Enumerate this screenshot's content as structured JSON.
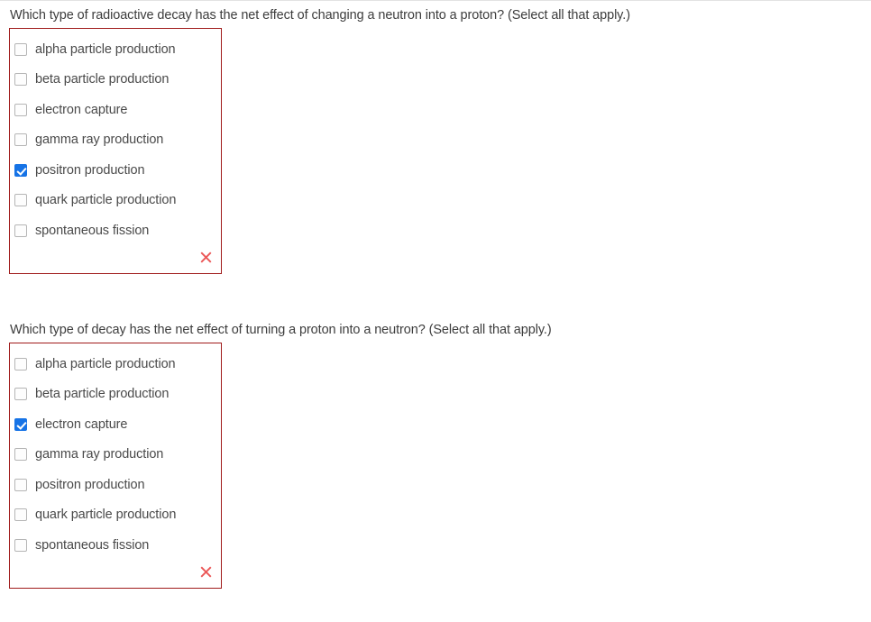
{
  "colors": {
    "box_border": "#a01b1b",
    "checkbox_checked": "#1673e6",
    "x_mark": "#eb5757",
    "question_text": "#3d3d3d",
    "option_text": "#4a4a4a",
    "top_rule": "#e2e2e2"
  },
  "questions": [
    {
      "id": "q1",
      "prompt": "Which type of radioactive decay has the net effect of changing a neutron into a proton? (Select all that apply.)",
      "result_icon": "x-mark-icon",
      "options": [
        {
          "label": "alpha particle production",
          "checked": false
        },
        {
          "label": "beta particle production",
          "checked": false
        },
        {
          "label": "electron capture",
          "checked": false
        },
        {
          "label": "gamma ray production",
          "checked": false
        },
        {
          "label": "positron production",
          "checked": true
        },
        {
          "label": "quark particle production",
          "checked": false
        },
        {
          "label": "spontaneous fission",
          "checked": false
        }
      ]
    },
    {
      "id": "q2",
      "prompt": "Which type of decay has the net effect of turning a proton into a neutron? (Select all that apply.)",
      "result_icon": "x-mark-icon",
      "options": [
        {
          "label": "alpha particle production",
          "checked": false
        },
        {
          "label": "beta particle production",
          "checked": false
        },
        {
          "label": "electron capture",
          "checked": true
        },
        {
          "label": "gamma ray production",
          "checked": false
        },
        {
          "label": "positron production",
          "checked": false
        },
        {
          "label": "quark particle production",
          "checked": false
        },
        {
          "label": "spontaneous fission",
          "checked": false
        }
      ]
    }
  ]
}
